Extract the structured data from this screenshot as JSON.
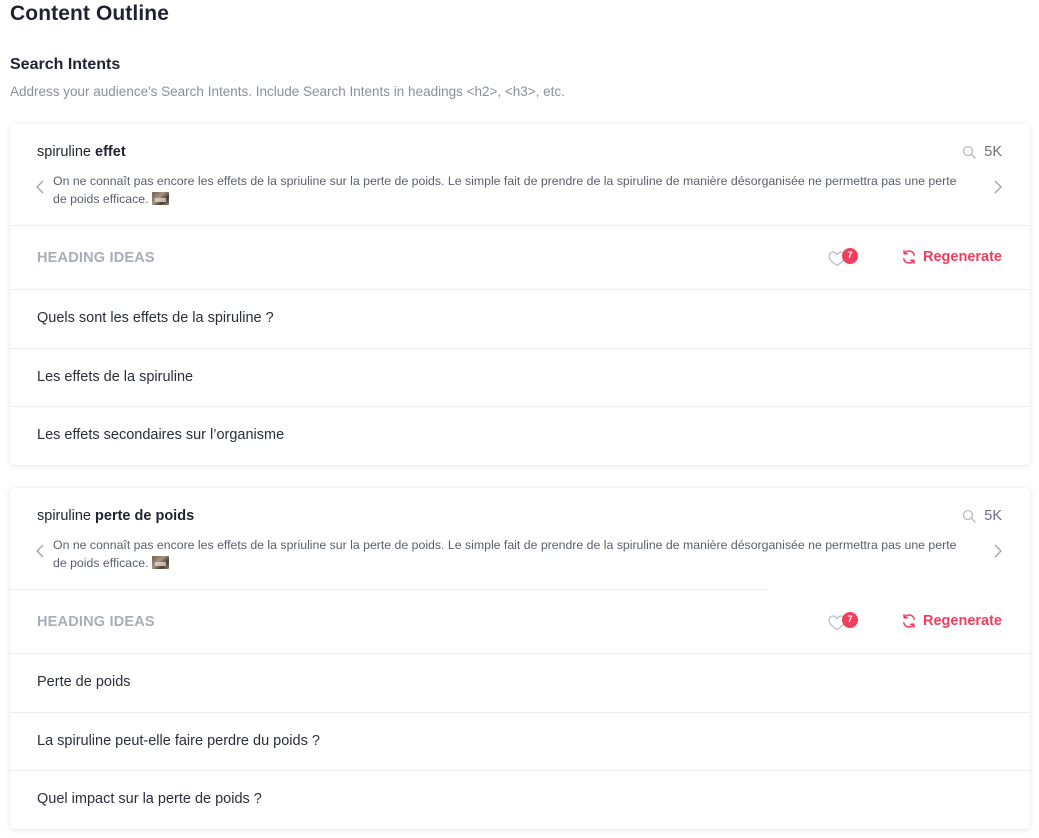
{
  "page": {
    "title": "Content Outline"
  },
  "section": {
    "title": "Search Intents",
    "description": "Address your audience's Search Intents. Include Search Intents in headings <h2>, <h3>, etc."
  },
  "colors": {
    "accent": "#f03e5d",
    "muted": "#a9adb8",
    "text": "#1f2330"
  },
  "intents": [
    {
      "keyword_prefix": "spiruline ",
      "keyword_bold": "effet",
      "volume": "5K",
      "volume_icon": "search-icon",
      "snippet": "On ne connaît pas encore les effets de la spriuline sur la perte de poids. Le simple fait de prendre de la spiruline de manière désorganisée ne permettra pas une perte de poids efficace.",
      "heading_ideas_label": "HEADING IDEAS",
      "favorites_count": "7",
      "regenerate_label": "Regenerate",
      "ideas": [
        "Quels sont les effets de la spiruline ?",
        "Les effets de la spiruline",
        "Les effets secondaires sur l’organisme"
      ]
    },
    {
      "keyword_prefix": "spiruline ",
      "keyword_bold": "perte de poids",
      "volume": "5K",
      "volume_icon": "search-icon",
      "snippet": "On ne connaît pas encore les effets de la spriuline sur la perte de poids. Le simple fait de prendre de la spiruline de manière désorganisée ne permettra pas une perte de poids efficace.",
      "heading_ideas_label": "HEADING IDEAS",
      "favorites_count": "7",
      "regenerate_label": "Regenerate",
      "ideas": [
        "Perte de poids",
        "La spiruline peut-elle faire perdre du poids ?",
        "Quel impact sur la perte de poids ?"
      ]
    }
  ]
}
